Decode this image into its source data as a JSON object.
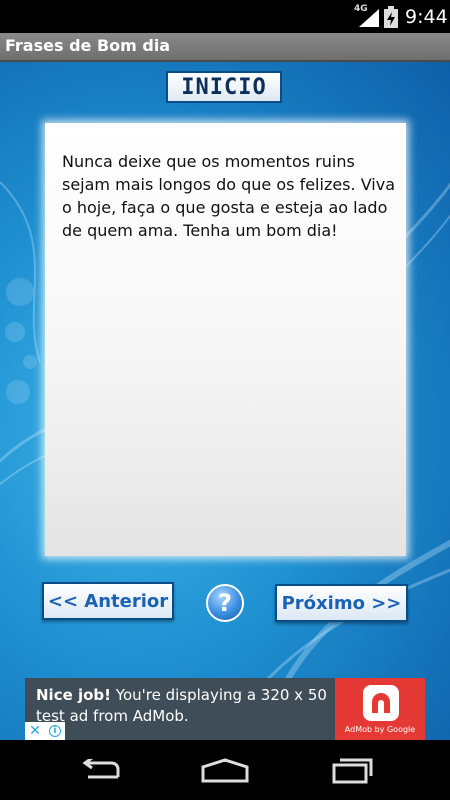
{
  "status_bar": {
    "network": "4G",
    "time": "9:44"
  },
  "app": {
    "title": "Frases de Bom dia"
  },
  "header": {
    "inicio_label": "INICIO"
  },
  "quote": {
    "text": "Nunca deixe que os momentos ruins sejam mais longos do que os felizes. Viva o hoje, faça o que gosta e esteja ao lado de quem ama. Tenha um bom dia!"
  },
  "controls": {
    "prev_label": "<< Anterior",
    "next_label": "Próximo >>",
    "help_label": "?"
  },
  "ad": {
    "headline": "Nice job!",
    "body": " You're displaying a 320 x 50 test ad from AdMob.",
    "caption": "AdMob by Google",
    "brand_color": "#e53935"
  },
  "colors": {
    "accent_blue": "#1a62b4",
    "background_blue": "#1e8fd0"
  }
}
